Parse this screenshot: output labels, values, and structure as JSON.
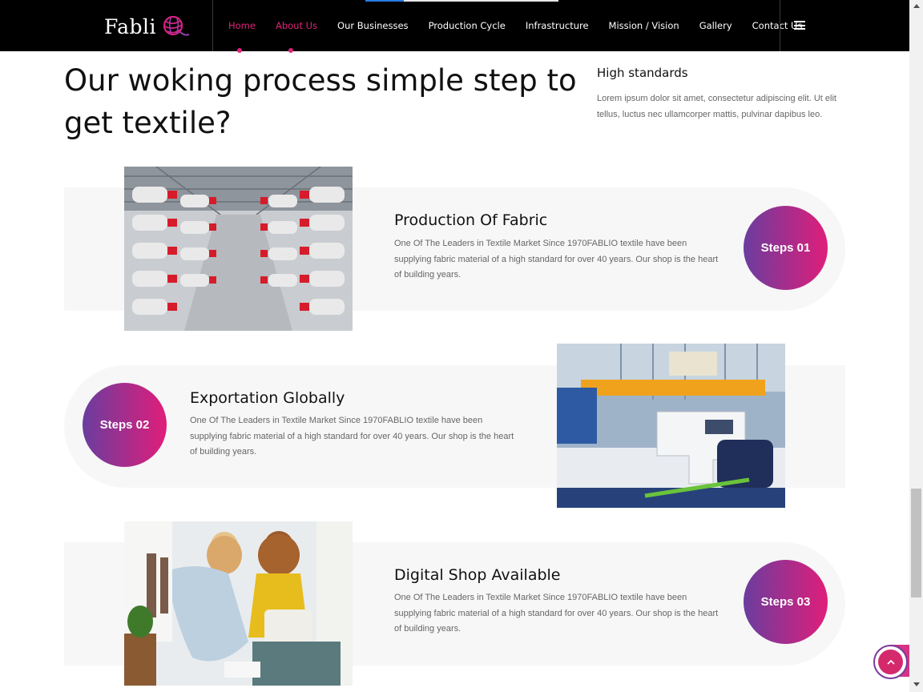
{
  "header": {
    "logo_text": "Fabli",
    "nav": [
      {
        "label": "Home",
        "active": true
      },
      {
        "label": "About Us",
        "active": true
      },
      {
        "label": "Our Businesses",
        "active": false
      },
      {
        "label": "Production Cycle",
        "active": false
      },
      {
        "label": "Infrastructure",
        "active": false
      },
      {
        "label": "Mission / Vision",
        "active": false
      },
      {
        "label": "Gallery",
        "active": false
      },
      {
        "label": "Contact Us",
        "active": false
      }
    ],
    "menu_icon": "hamburger-icon"
  },
  "intro": {
    "title": "Our woking process simple step to get textile?",
    "side_title": "High standards",
    "side_text": "Lorem ipsum dolor sit amet, consectetur adipiscing elit. Ut elit tellus, luctus nec ullamcorper mattis, pulvinar dapibus leo."
  },
  "steps": [
    {
      "badge": "Steps 01",
      "title": "Production Of Fabric",
      "text": "One Of The Leaders in Textile Market Since 1970FABLIO textile have been supplying fabric material of a high standard for over 40 years. Our shop is the heart of building years.",
      "image": "thread-spools-factory"
    },
    {
      "badge": "Steps 02",
      "title": "Exportation Globally",
      "text": "One Of The Leaders in Textile Market Since 1970FABLIO textile have been supplying fabric material of a high standard for over 40 years. Our shop is the heart of building years.",
      "image": "sewing-machine-workshop"
    },
    {
      "badge": "Steps 03",
      "title": "Digital Shop Available",
      "text": "One Of The Leaders in Textile Market Since 1970FABLIO textile have been supplying fabric material of a high standard for over 40 years. Our shop is the heart of building years.",
      "image": "women-tailoring-shop"
    }
  ],
  "colors": {
    "accent": "#e0247a",
    "gradient_start": "#6a3d9e",
    "gradient_end": "#e01e7a",
    "header_bg": "#000000",
    "row_bg": "#f7f7f7"
  },
  "back_to_top": {
    "icon": "chevron-up-icon"
  }
}
